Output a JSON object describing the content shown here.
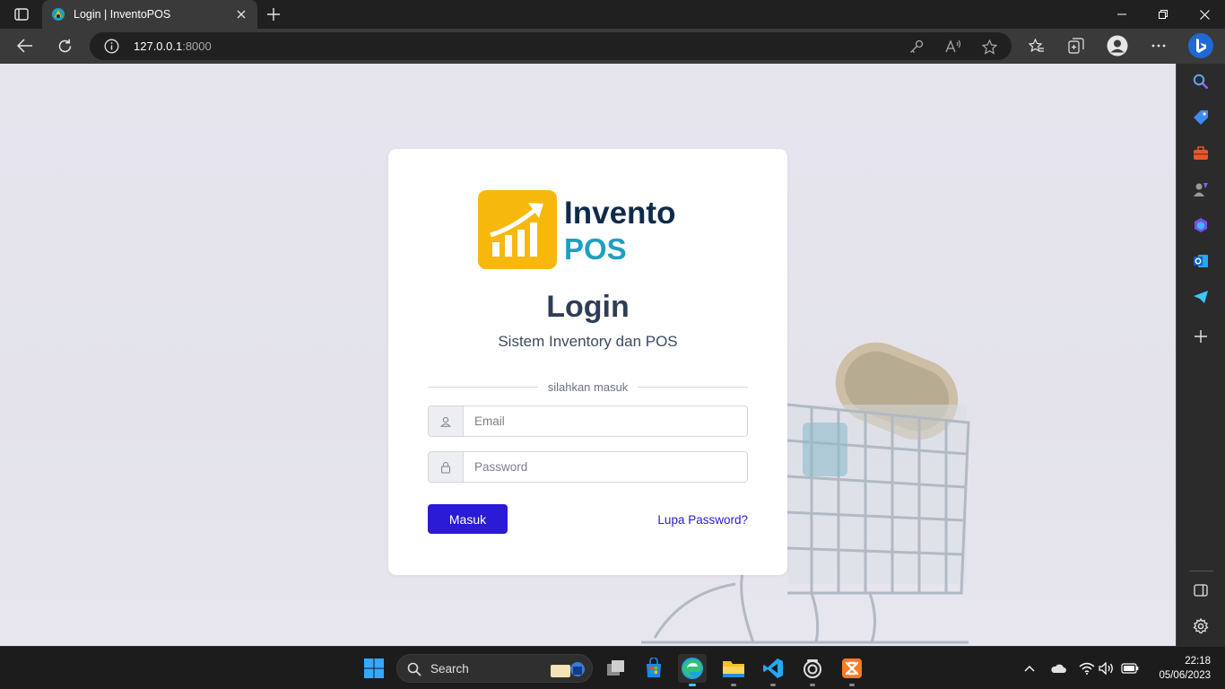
{
  "browser": {
    "tab_title": "Login | InventoPOS",
    "url_host": "127.0.0.1",
    "url_port": ":8000"
  },
  "page": {
    "brand_line1": "Invento",
    "brand_line2": "POS",
    "title": "Login",
    "subtitle": "Sistem Inventory dan POS",
    "divider_text": "silahkan masuk",
    "email_placeholder": "Email",
    "password_placeholder": "Password",
    "submit_label": "Masuk",
    "forgot_label": "Lupa Password?",
    "colors": {
      "accent": "#2b1ad6",
      "brand_dark": "#0f2b4a",
      "brand_teal": "#1f9fc0",
      "logo_yellow": "#f7b80d"
    }
  },
  "taskbar": {
    "search_label": "Search",
    "time": "22:18",
    "date": "05/06/2023"
  },
  "icons": {
    "titlebar": [
      "tab-actions-icon",
      "favicon-icon",
      "close-tab-icon",
      "new-tab-icon",
      "minimize-icon",
      "restore-icon",
      "close-window-icon"
    ],
    "toolbar": [
      "back-icon",
      "refresh-icon",
      "info-icon",
      "key-icon",
      "read-aloud-icon",
      "star-icon",
      "favorites-icon",
      "collections-icon",
      "profile-icon",
      "more-icon",
      "bing-icon"
    ],
    "sidebar": [
      "search-icon",
      "shopping-tag-icon",
      "tools-icon",
      "games-icon",
      "office-icon",
      "outlook-icon",
      "telegram-icon",
      "add-icon",
      "sidebar-toggle-icon",
      "settings-icon"
    ],
    "taskbar": [
      "windows-start-icon",
      "search-icon",
      "task-view-icon",
      "store-icon",
      "edge-icon",
      "file-explorer-icon",
      "vscode-icon",
      "obs-icon",
      "xampp-icon",
      "chevron-up-icon",
      "onedrive-icon",
      "wifi-icon",
      "volume-icon",
      "battery-icon"
    ]
  }
}
